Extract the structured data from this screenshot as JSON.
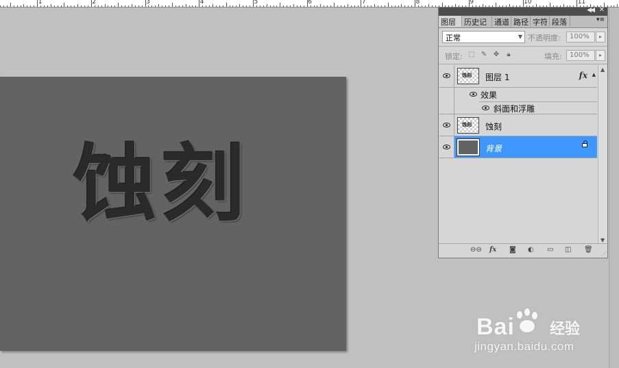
{
  "ruler": {
    "labels": [
      "1",
      "2",
      "3",
      "4",
      "5",
      "6",
      "7",
      "8",
      "9",
      "10",
      "11"
    ]
  },
  "canvas": {
    "text": "蚀刻"
  },
  "layers_panel": {
    "tabs": [
      "图层",
      "历史记",
      "通道",
      "路径",
      "字符",
      "段落"
    ],
    "active_tab": "图层",
    "blend_mode": "正常",
    "opacity_label": "不透明度:",
    "opacity_value": "100%",
    "lock_label": "锁定:",
    "fill_label": "填充:",
    "fill_value": "100%",
    "layers": [
      {
        "name": "图层 1",
        "has_fx": true,
        "thumb_text": "蚀刻"
      },
      {
        "effects_label": "效果",
        "effect_name": "斜面和浮雕"
      },
      {
        "name": "蚀刻",
        "thumb_text": "蚀刻"
      },
      {
        "name": "背景",
        "selected": true,
        "locked": true
      }
    ],
    "fx_label": "fx"
  },
  "watermark": {
    "brand": "Bai",
    "brand2": "经验",
    "url": "jingyan.baidu.com"
  }
}
